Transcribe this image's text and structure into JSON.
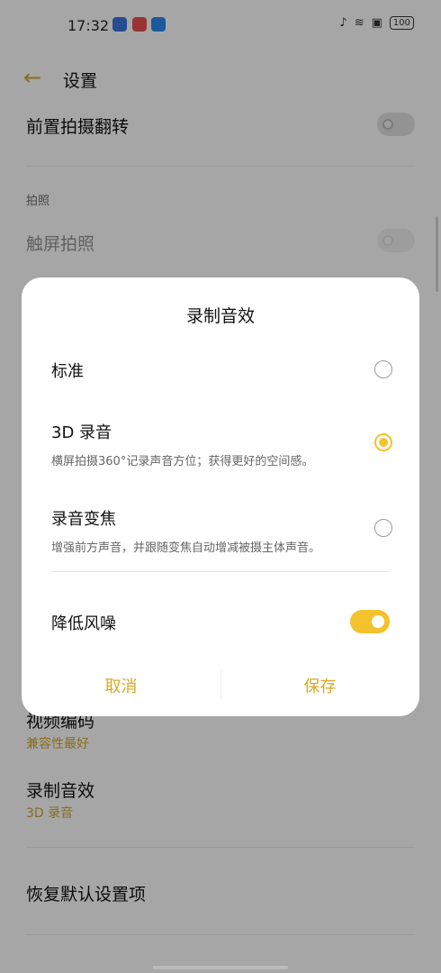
{
  "status_bar": {
    "time": "17:32",
    "battery": "100"
  },
  "header": {
    "title": "设置"
  },
  "settings": {
    "front_flip_label": "前置拍摄翻转",
    "section_photo": "拍照",
    "touch_shoot_label": "触屏拍照",
    "video_encoding_label": "视频编码",
    "video_encoding_value": "兼容性最好",
    "audio_effect_label": "录制音效",
    "audio_effect_value": "3D 录音",
    "restore_defaults_label": "恢复默认设置项"
  },
  "dialog": {
    "title": "录制音效",
    "options": [
      {
        "label": "标准",
        "desc": "",
        "selected": false
      },
      {
        "label": "3D 录音",
        "desc": "横屏拍摄360°记录声音方位；获得更好的空间感。",
        "selected": true
      },
      {
        "label": "录音变焦",
        "desc": "增强前方声音，并跟随变焦自动增减被摄主体声音。",
        "selected": false
      }
    ],
    "noise_reduction_label": "降低风噪",
    "noise_reduction_on": true,
    "cancel_label": "取消",
    "save_label": "保存"
  },
  "colors": {
    "accent": "#f4c22d",
    "accent_text": "#c9a22e"
  }
}
